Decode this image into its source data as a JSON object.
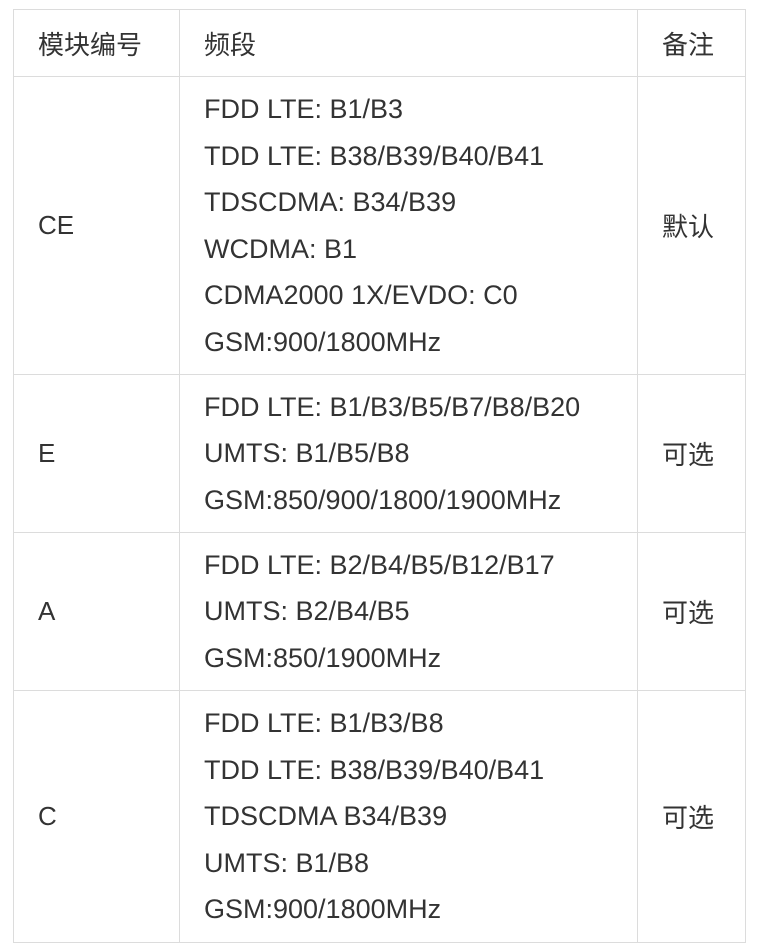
{
  "table": {
    "headers": {
      "module": "模块编号",
      "band": "频段",
      "note": "备注"
    },
    "rows": [
      {
        "model": "CE",
        "bands": [
          "FDD LTE: B1/B3",
          "TDD LTE: B38/B39/B40/B41",
          "TDSCDMA: B34/B39",
          "WCDMA: B1",
          "CDMA2000 1X/EVDO: C0",
          "GSM:900/1800MHz"
        ],
        "note": "默认"
      },
      {
        "model": "E",
        "bands": [
          "FDD LTE: B1/B3/B5/B7/B8/B20",
          "UMTS: B1/B5/B8",
          "GSM:850/900/1800/1900MHz"
        ],
        "note": "可选"
      },
      {
        "model": "A",
        "bands": [
          "FDD LTE: B2/B4/B5/B12/B17",
          "UMTS: B2/B4/B5",
          "GSM:850/1900MHz"
        ],
        "note": "可选"
      },
      {
        "model": "C",
        "bands": [
          "FDD LTE: B1/B3/B8",
          "TDD LTE: B38/B39/B40/B41",
          "TDSCDMA B34/B39",
          "UMTS: B1/B8",
          "GSM:900/1800MHz"
        ],
        "note": "可选"
      }
    ]
  }
}
